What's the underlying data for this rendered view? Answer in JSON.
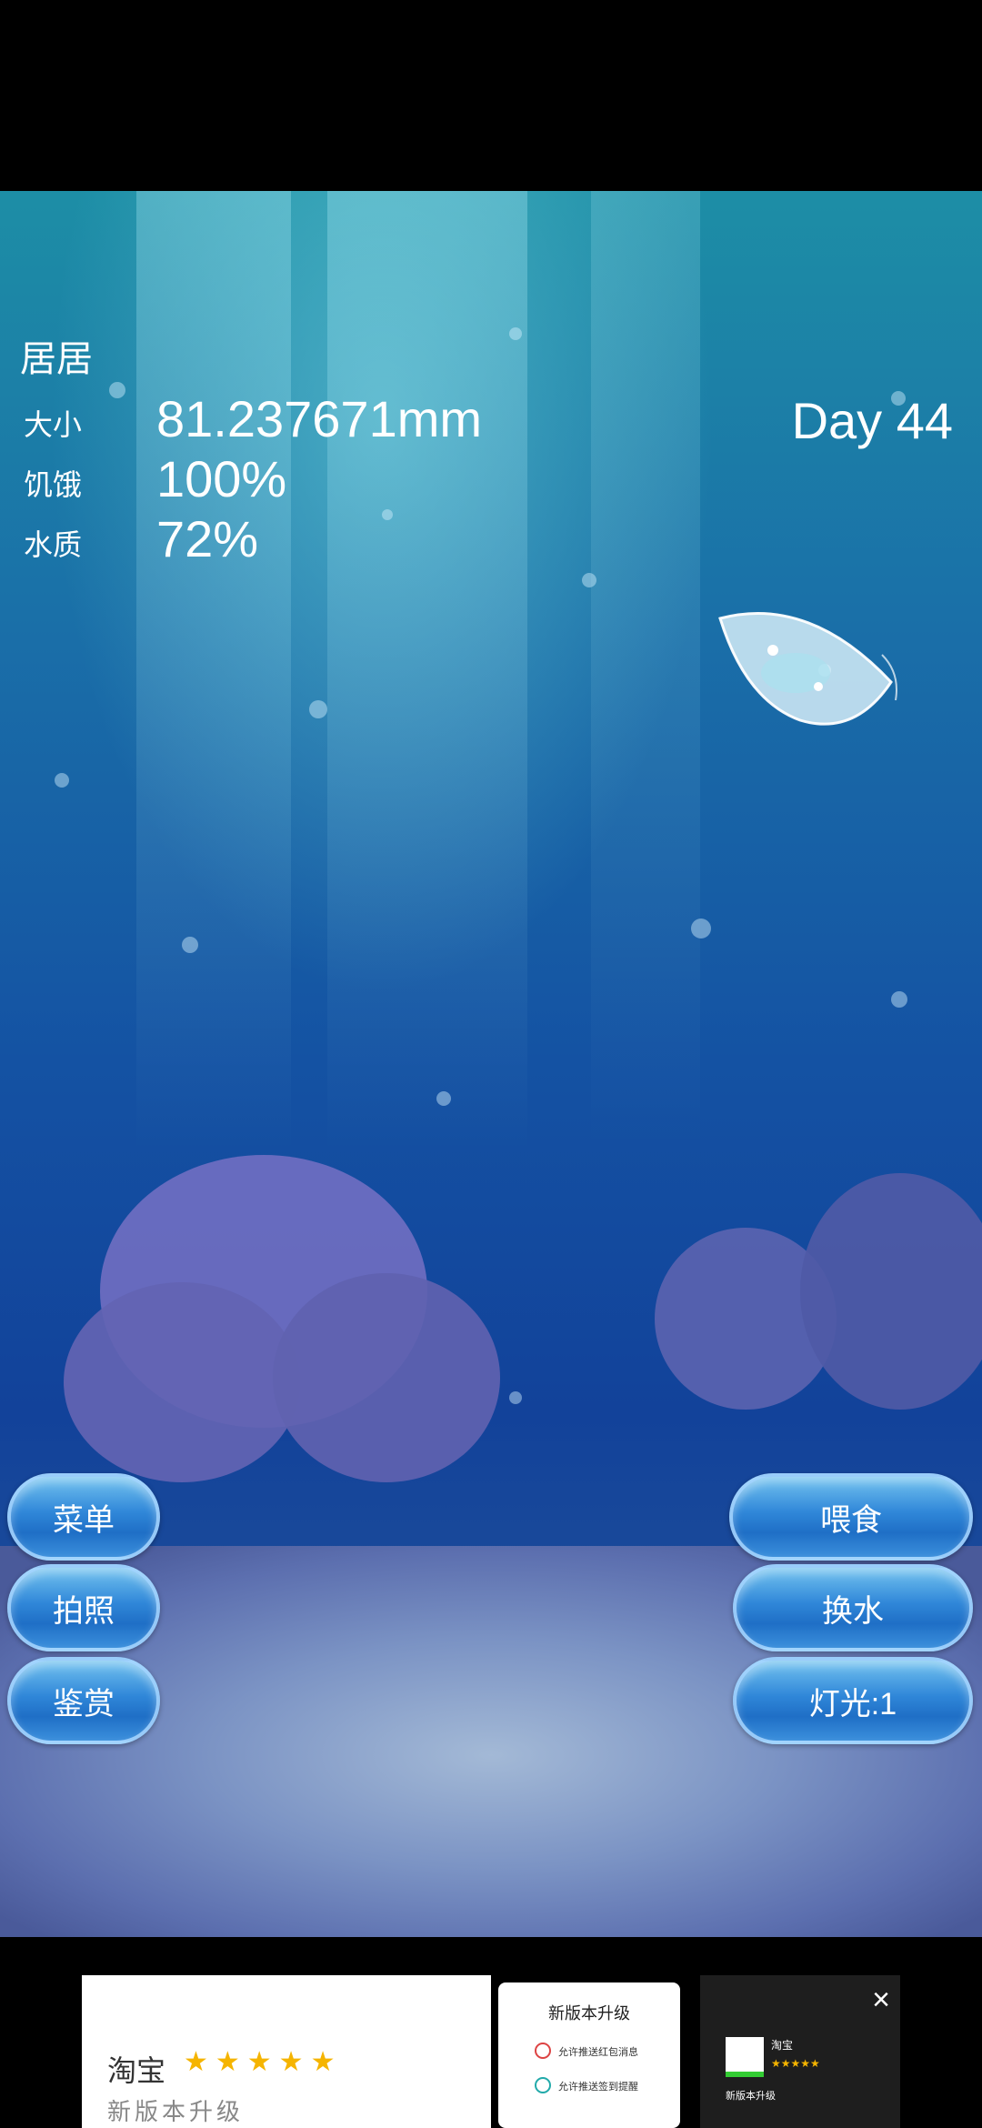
{
  "pet": {
    "name": "居居"
  },
  "stats": [
    {
      "label": "大小",
      "value": "81.237671mm"
    },
    {
      "label": "饥饿",
      "value": "100%"
    },
    {
      "label": "水质",
      "value": "72%"
    }
  ],
  "day": "Day 44",
  "left_buttons": [
    "菜单",
    "拍照",
    "鉴赏"
  ],
  "right_buttons": [
    "喂食",
    "换水",
    "灯光:1"
  ],
  "ad": {
    "brand": "淘宝",
    "stars": "★★★★★",
    "subtitle": "新版本升级",
    "dialog_title": "新版本升级",
    "dialog_rows": [
      "允许推送红包消息",
      "允许推送签到提醒"
    ],
    "app_name": "淘宝",
    "app_rating": "★★★★★",
    "app_caption": "新版本升级",
    "close_icon": "×"
  }
}
